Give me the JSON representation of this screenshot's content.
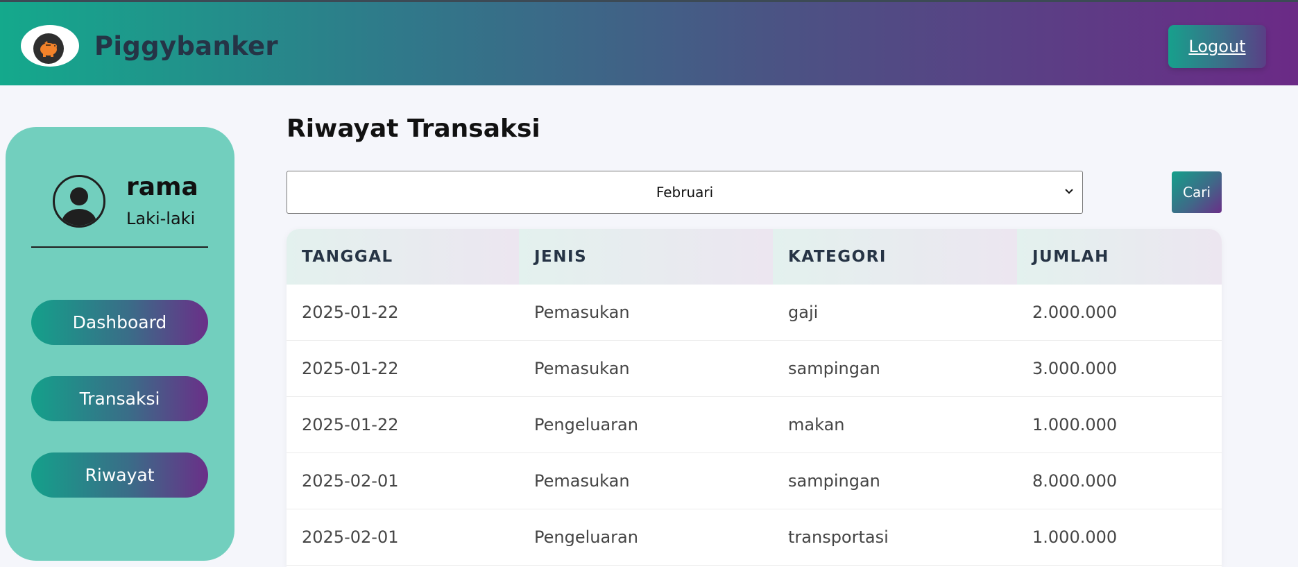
{
  "header": {
    "brand": "Piggybanker",
    "logout_label": "Logout",
    "logo_icon": "piggy-bank-icon",
    "colors": {
      "gradient_start": "#14a98c",
      "gradient_end": "#6b2a86",
      "brand_text": "#253446"
    }
  },
  "sidebar": {
    "user": {
      "name": "rama",
      "gender": "Laki-laki",
      "avatar_icon": "user-avatar-icon"
    },
    "nav": [
      {
        "label": "Dashboard"
      },
      {
        "label": "Transaksi"
      },
      {
        "label": "Riwayat"
      }
    ],
    "colors": {
      "background": "#72cfbe"
    }
  },
  "main": {
    "title": "Riwayat Transaksi",
    "filter": {
      "selected_month": "Februari",
      "search_label": "Cari"
    },
    "table": {
      "headers": [
        "TANGGAL",
        "JENIS",
        "KATEGORI",
        "JUMLAH"
      ],
      "rows": [
        [
          "2025-01-22",
          "Pemasukan",
          "gaji",
          "2.000.000"
        ],
        [
          "2025-01-22",
          "Pemasukan",
          "sampingan",
          "3.000.000"
        ],
        [
          "2025-01-22",
          "Pengeluaran",
          "makan",
          "1.000.000"
        ],
        [
          "2025-02-01",
          "Pemasukan",
          "sampingan",
          "8.000.000"
        ],
        [
          "2025-02-01",
          "Pengeluaran",
          "transportasi",
          "1.000.000"
        ]
      ]
    }
  }
}
